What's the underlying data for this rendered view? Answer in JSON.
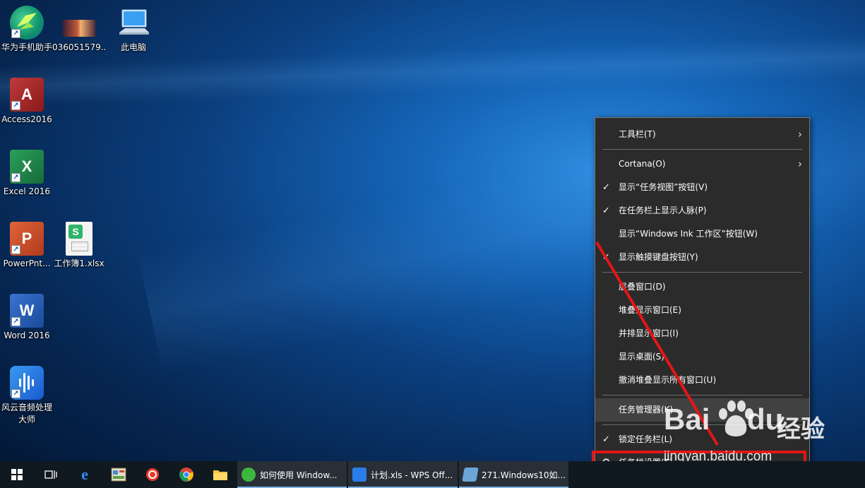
{
  "desktop": {
    "icons": [
      {
        "label": "华为手机助手",
        "icon": "huawei-assistant-icon"
      },
      {
        "label": "036051579...",
        "icon": "image-thumbnail-icon"
      },
      {
        "label": "此电脑",
        "icon": "this-pc-icon"
      },
      {
        "label": "Access2016",
        "icon": "access-icon",
        "glyph": "A"
      },
      {
        "label": "Excel 2016",
        "icon": "excel-icon",
        "glyph": "X"
      },
      {
        "label": "PowerPnt...",
        "icon": "powerpoint-icon",
        "glyph": "P"
      },
      {
        "label": "工作簿1.xlsx",
        "icon": "wps-sheet-icon",
        "glyph": "S"
      },
      {
        "label": "Word 2016",
        "icon": "word-icon",
        "glyph": "W"
      },
      {
        "label": "风云音频处理大师",
        "icon": "audio-editor-icon"
      }
    ]
  },
  "context_menu": {
    "items": [
      {
        "label": "工具栏(T)",
        "submenu": true
      },
      {
        "label": "Cortana(O)",
        "submenu": true
      },
      {
        "label": "显示“任务视图”按钮(V)",
        "checked": true
      },
      {
        "label": "在任务栏上显示人脉(P)",
        "checked": true
      },
      {
        "label": "显示“Windows Ink 工作区”按钮(W)"
      },
      {
        "label": "显示触摸键盘按钮(Y)",
        "checked": true
      },
      {
        "label": "层叠窗口(D)"
      },
      {
        "label": "堆叠显示窗口(E)"
      },
      {
        "label": "并排显示窗口(I)"
      },
      {
        "label": "显示桌面(S)"
      },
      {
        "label": "撤消堆叠显示所有窗口(U)"
      },
      {
        "label": "任务管理器(K)",
        "highlighted": true
      },
      {
        "label": "锁定任务栏(L)",
        "checked": true
      },
      {
        "label": "任务栏设置(T)",
        "icon": "gear-icon"
      }
    ],
    "check_glyph": "✓",
    "arrow_glyph": "›",
    "gear_glyph": "⚙"
  },
  "watermark": {
    "brand_left": "Bai",
    "brand_right": "du",
    "brand_cn": "经验",
    "url": "jingyan.baidu.com"
  },
  "taskbar": {
    "apps": [
      {
        "label": "如何使用 Window...",
        "icon": "browser-360-icon",
        "color": "#3db83d"
      },
      {
        "label": "计划.xls - WPS Off...",
        "icon": "wps-icon",
        "color": "#2b7de9"
      },
      {
        "label": "271.Windows10如...",
        "icon": "notepad-icon",
        "color": "#6aa6d8"
      }
    ]
  },
  "colors": {
    "annotation": "#e31616",
    "menu_bg": "#2b2b2b",
    "taskbar_bg": "#101820"
  }
}
